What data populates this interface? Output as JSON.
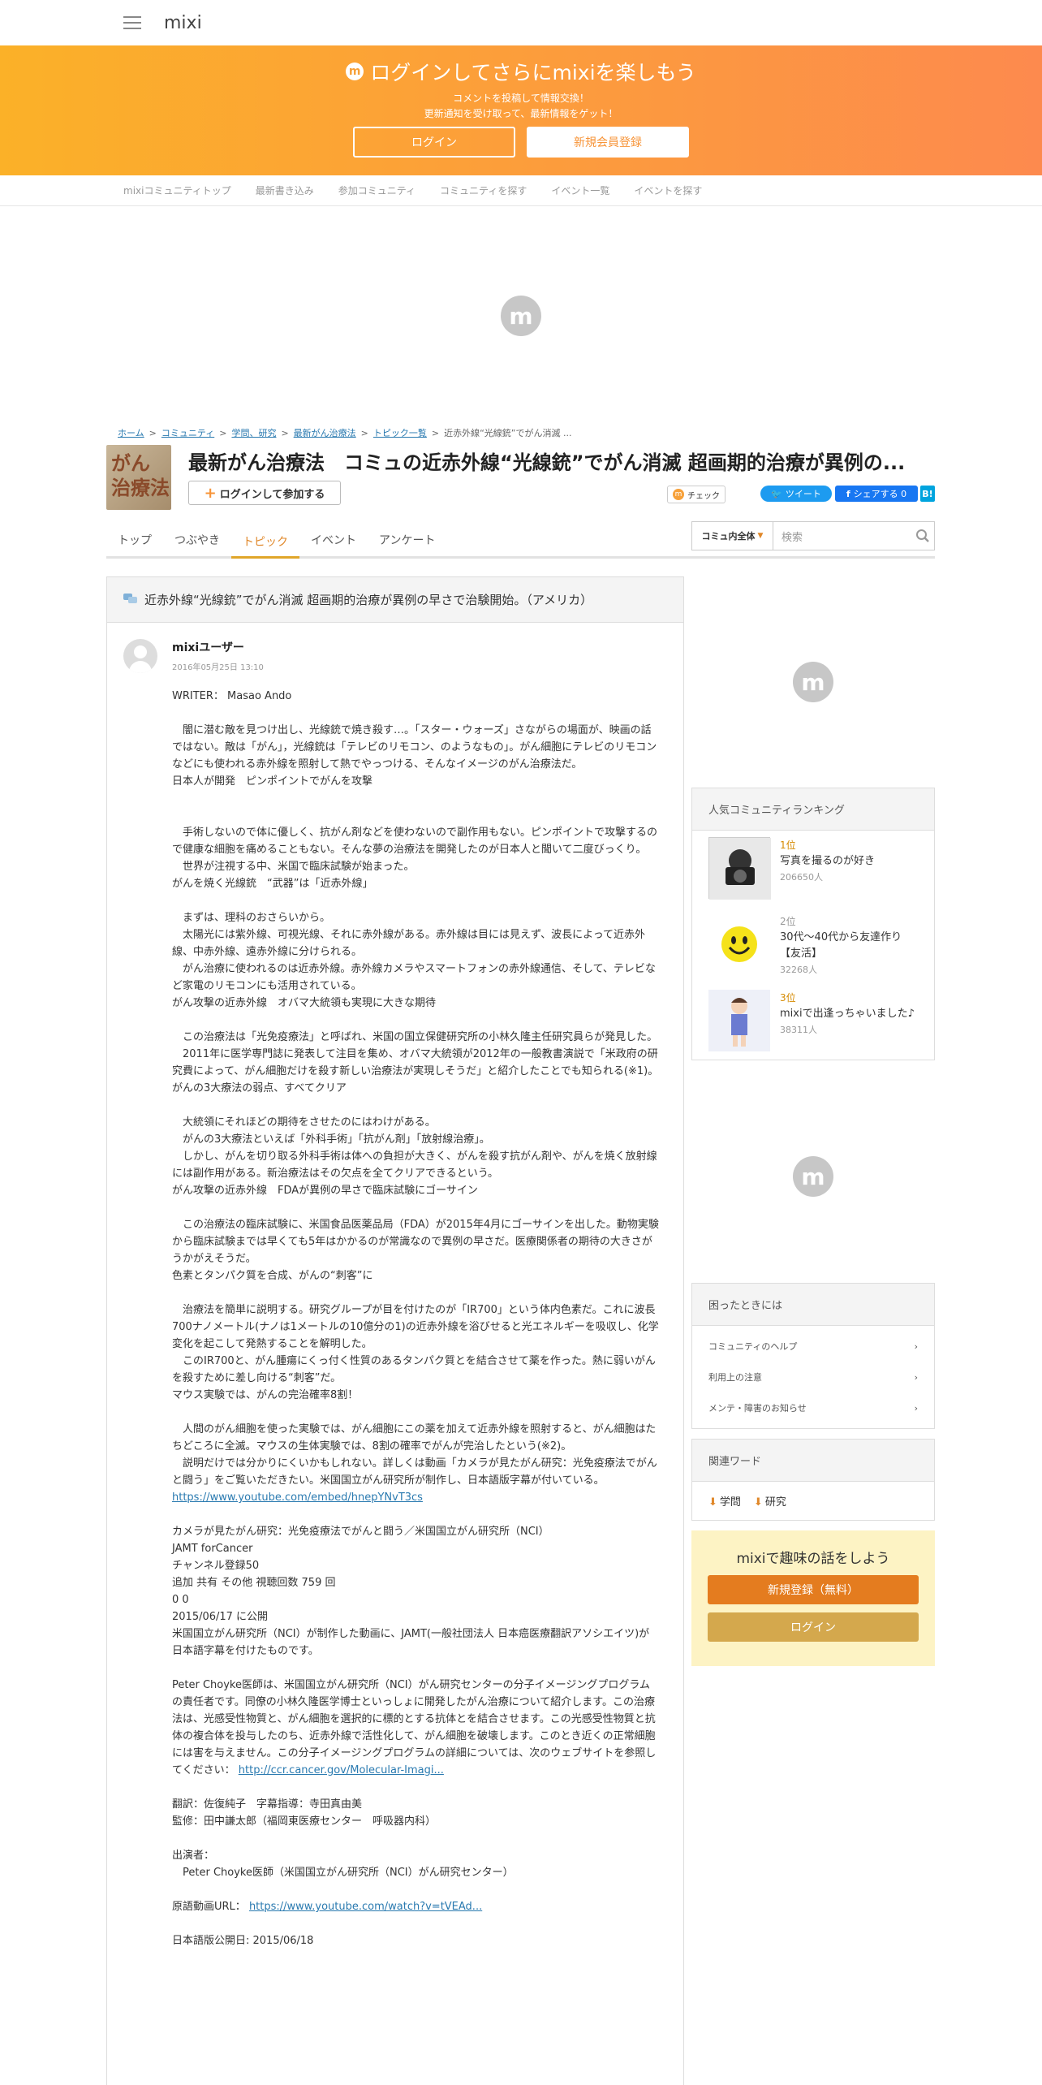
{
  "app": {
    "logo": "mixi"
  },
  "banner": {
    "title": "ログインしてさらにmixiを楽しもう",
    "line1": "コメントを投稿して情報交換！",
    "line2": "更新通知を受け取って、最新情報をゲット！",
    "login_label": "ログイン",
    "register_label": "新規会員登録"
  },
  "subnav": [
    "mixiコミュニティトップ",
    "最新書き込み",
    "参加コミュニティ",
    "コミュニティを探す",
    "イベント一覧",
    "イベントを探す"
  ],
  "breadcrumb": [
    "ホーム",
    "コミュニティ",
    "学問、研究",
    "最新がん治療法",
    "トピック一覧",
    "近赤外線“光線銃”でがん消滅 ..."
  ],
  "community": {
    "thumb_text": "がん\n治療法",
    "title": "最新がん治療法　コミュの近赤外線“光線銃”でがん消滅 超画期的治療が異例の...",
    "join_label": "ログインして参加する",
    "check_label": "チェック",
    "tweet_label": "ツイート",
    "share_label": "シェアする 0",
    "hatena_label": "B!"
  },
  "tabs": [
    "トップ",
    "つぶやき",
    "トピック",
    "イベント",
    "アンケート"
  ],
  "search": {
    "scope": "コミュ内全体",
    "placeholder": "検索"
  },
  "topic": {
    "title": "近赤外線“光線銃”でがん消滅 超画期的治療が異例の早さで治験開始。（アメリカ）",
    "author": "mixiユーザー",
    "date": "2016年05月25日 13:10",
    "body": "WRITER： Masao Ando\n\n　闇に潜む敵を見つけ出し、光線銃で焼き殺す…。「スター・ウォーズ」さながらの場面が、映画の話ではない。敵は「がん」，光線銃は「テレビのリモコン、のようなもの」。がん細胞にテレビのリモコンなどにも使われる赤外線を照射して熱でやっつける、そんなイメージのがん治療法だ。\n日本人が開発　ピンポイントでがんを攻撃\n\n\n　手術しないので体に優しく、抗がん剤などを使わないので副作用もない。ピンポイントで攻撃するので健康な細胞を痛めることもない。そんな夢の治療法を開発したのが日本人と聞いて二度びっくり。\n　世界が注視する中、米国で臨床試験が始まった。\nがんを焼く光線銃　“武器”は「近赤外線」\n\n　まずは、理科のおさらいから。\n　太陽光には紫外線、可視光線、それに赤外線がある。赤外線は目には見えず、波長によって近赤外線、中赤外線、遠赤外線に分けられる。\n　がん治療に使われるのは近赤外線。赤外線カメラやスマートフォンの赤外線通信、そして、テレビなど家電のリモコンにも活用されている。\nがん攻撃の近赤外線　オバマ大統領も実現に大きな期待\n\n　この治療法は「光免疫療法」と呼ばれ、米国の国立保健研究所の小林久隆主任研究員らが発見した。\n　2011年に医学専門誌に発表して注目を集め、オバマ大統領が2012年の一般教書演説で「米政府の研究費によって、がん細胞だけを殺す新しい治療法が実現しそうだ」と紹介したことでも知られる(※1)。\nがんの3大療法の弱点、すべてクリア\n\n　大統領にそれほどの期待をさせたのにはわけがある。\n　がんの3大療法といえば「外科手術」「抗がん剤」「放射線治療」。\n　しかし、がんを切り取る外科手術は体への負担が大きく、がんを殺す抗がん剤や、がんを焼く放射線には副作用がある。新治療法はその欠点を全てクリアできるという。\nがん攻撃の近赤外線　FDAが異例の早さで臨床試験にゴーサイン\n\n　この治療法の臨床試験に、米国食品医薬品局（FDA）が2015年4月にゴーサインを出した。動物実験から臨床試験までは早くても5年はかかるのが常識なので異例の早さだ。医療関係者の期待の大きさがうかがえそうだ。\n色素とタンパク質を合成、がんの“刺客”に\n\n　治療法を簡単に説明する。研究グループが目を付けたのが「IR700」という体内色素だ。これに波長700ナノメートル(ナノは1メートルの10億分の1)の近赤外線を浴びせると光エネルギーを吸収し、化学変化を起こして発熱することを解明した。\n　このIR700と、がん腫瘍にくっ付く性質のあるタンパク質とを結合させて薬を作った。熱に弱いがんを殺すために差し向ける“刺客”だ。\nマウス実験では、がんの完治確率8割！\n\n　人間のがん細胞を使った実験では、がん細胞にこの薬を加えて近赤外線を照射すると、がん細胞はたちどころに全滅。マウスの生体実験では、8割の確率でがんが完治したという(※2)。\n　説明だけでは分かりにくいかもしれない。詳しくは動画「カメラが見たがん研究：光免疫療法でがんと闘う」をご覧いただきたい。米国国立がん研究所が制作し、日本語版字幕が付いている。",
    "link1": "https://www.youtube.com/embed/hnepYNvT3cs",
    "body2": "カメラが見たがん研究：光免疫療法でがんと闘う／米国国立がん研究所（NCI）\nJAMT forCancer\nチャンネル登録50\n追加 共有 その他 視聴回数 759 回\n0 0\n2015/06/17 に公開\n米国国立がん研究所（NCI）が制作した動画に、JAMT(一般社団法人 日本癌医療翻訳アソシエイツ)が日本語字幕を付けたものです。\n\nPeter Choyke医師は、米国国立がん研究所（NCI）がん研究センターの分子イメージングプログラムの責任者です。同僚の小林久隆医学博士といっしょに開発したがん治療について紹介します。この治療法は、光感受性物質と、がん細胞を選択的に標的とする抗体とを結合させます。この光感受性物質と抗体の複合体を投与したのち、近赤外線で活性化して、がん細胞を破壊します。このとき近くの正常細胞には害を与えません。この分子イメージングプログラムの詳細については、次のウェブサイトを参照してください：",
    "link2": "http://ccr.cancer.gov/Molecular-Imagi...",
    "body3": "翻訳：佐復純子　字幕指導：寺田真由美\n監修：田中謙太郎（福岡東医療センター　呼吸器内科）\n\n出演者：\n　Peter Choyke医師（米国国立がん研究所（NCI）がん研究センター）\n\n原語動画URL：",
    "link3": "https://www.youtube.com/watch?v=tVEAd...",
    "body4": "日本語版公開日: 2015/06/18"
  },
  "ranking": {
    "title": "人気コミュニティランキング",
    "items": [
      {
        "rank": "1位",
        "name": "写真を撮るのが好き",
        "count": "206650人"
      },
      {
        "rank": "2位",
        "name": "30代～40代から友達作り【友活】",
        "count": "32268人"
      },
      {
        "rank": "3位",
        "name": "mixiで出逢っちゃいました♪",
        "count": "38311人"
      }
    ]
  },
  "help": {
    "title": "困ったときには",
    "items": [
      "コミュニティのヘルプ",
      "利用上の注意",
      "メンテ・障害のお知らせ"
    ]
  },
  "keywords": {
    "title": "関連ワード",
    "items": [
      "学問",
      "研究"
    ]
  },
  "promo": {
    "title": "mixiで趣味の話をしよう",
    "register_label": "新規登録（無料）",
    "login_label": "ログイン"
  },
  "colors": {
    "accent": "#f79438",
    "banner_start": "#fbb128",
    "banner_end": "#fd8a4e",
    "link": "#2a7ab0"
  }
}
